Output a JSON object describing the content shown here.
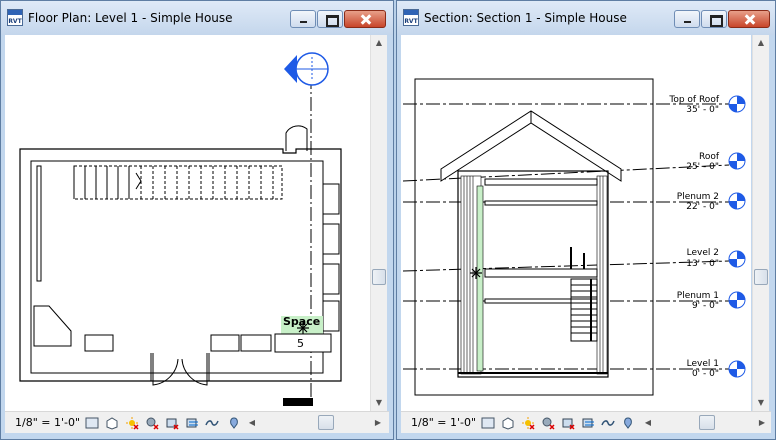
{
  "left_window": {
    "title": "Floor Plan: Level 1 - Simple House",
    "app_badge": "RVT",
    "scale": "1/8\" = 1'-0\"",
    "room_tag": {
      "name": "Space",
      "number": "5"
    }
  },
  "right_window": {
    "title": "Section: Section 1 - Simple House",
    "app_badge": "RVT",
    "scale": "1/8\" = 1'-0\"",
    "levels": [
      {
        "name": "Top of Roof",
        "elevation": "35' - 0\""
      },
      {
        "name": "Roof",
        "elevation": "25' - 0\""
      },
      {
        "name": "Plenum 2",
        "elevation": "22' - 0\""
      },
      {
        "name": "Level 2",
        "elevation": "13' - 0\""
      },
      {
        "name": "Plenum 1",
        "elevation": "9' - 0\""
      },
      {
        "name": "Level 1",
        "elevation": "0' - 0\""
      }
    ]
  },
  "view_controls": [
    "detail-level-icon",
    "visual-style-icon",
    "sun-path-icon",
    "shadows-icon",
    "crop-view-icon",
    "show-crop-icon",
    "temporary-hide-icon",
    "reveal-hidden-icon",
    "analysis-display-icon"
  ]
}
